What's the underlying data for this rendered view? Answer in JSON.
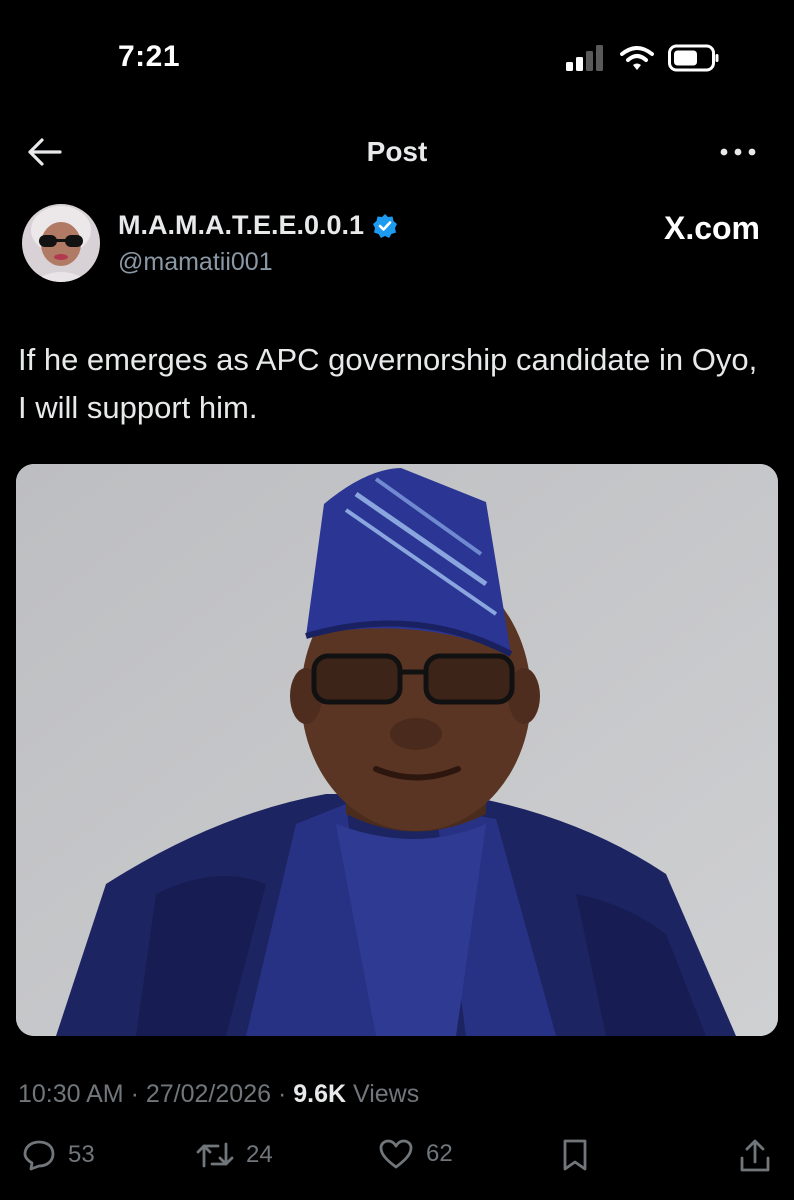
{
  "status_bar": {
    "time": "7:21",
    "signal_icon": "signal-bars-icon",
    "wifi_icon": "wifi-icon",
    "battery_icon": "battery-icon"
  },
  "nav": {
    "title": "Post",
    "back_icon": "back-arrow-icon",
    "more_icon": "more-dots-icon"
  },
  "author": {
    "display_name": "M.A.M.A.T.E.E.0.0.1",
    "handle": "@mamatii001",
    "verified_icon": "verified-badge-icon"
  },
  "watermark": "X.com",
  "tweet": {
    "text": "If he emerges as APC governorship candidate in Oyo, I will support him."
  },
  "meta": {
    "time": "10:30 AM",
    "date": "27/02/2026",
    "views_count": "9.6K",
    "views_label": "Views",
    "separator": "·"
  },
  "actions": {
    "replies": "53",
    "reposts": "24",
    "likes": "62",
    "reply_icon": "reply-bubble-icon",
    "repost_icon": "repost-icon",
    "like_icon": "heart-icon",
    "bookmark_icon": "bookmark-icon",
    "share_icon": "share-icon"
  },
  "colors": {
    "background": "#000000",
    "text": "#e7e9ea",
    "secondary": "#71767b",
    "verified": "#1d9bf0",
    "attire_blue": "#222a6e"
  }
}
